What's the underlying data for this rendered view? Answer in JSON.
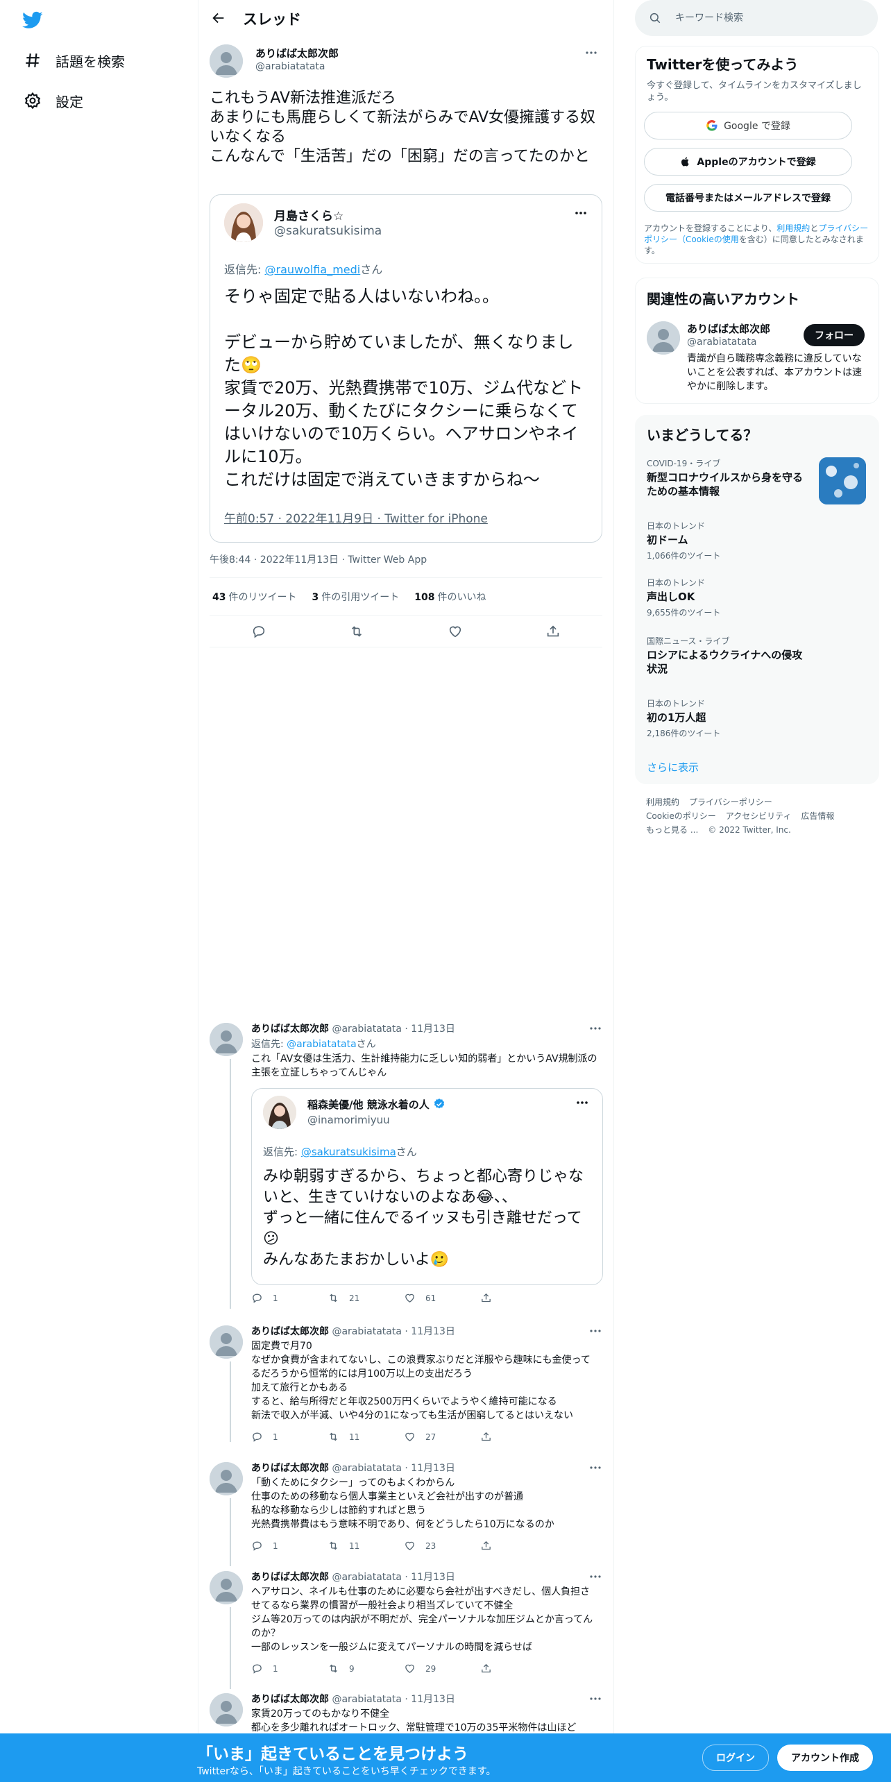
{
  "nav": {
    "explore_label": "話題を検索",
    "settings_label": "設定"
  },
  "thread": {
    "title": "スレッド"
  },
  "main_tweet": {
    "name": "ありばば太郎次郎",
    "handle": "@arabiatatata",
    "text": "これもうAV新法推進派だろ\nあまりにも馬鹿らしくて新法がらみでAV女優擁護する奴いなくなる\nこんなんで「生活苦」だの「困窮」だの言ってたのかと",
    "quote": {
      "name": "月島さくら☆",
      "handle": "@sakuratsukisima",
      "reply_prefix": "返信先: ",
      "reply_to": "@rauwolfia_medi",
      "reply_suffix": "さん",
      "text": "そりゃ固定で貼る人はいないわね。。\n\nデビューから貯めていましたが、無くなりました🙄\n家賃で20万、光熱費携帯で10万、ジム代などトータル20万、動くたびにタクシーに乗らなくてはいけないので10万くらい。ヘアサロンやネイルに10万。\nこれだけは固定で消えていきますからね〜",
      "meta": "午前0:57 · 2022年11月9日 · Twitter for iPhone"
    },
    "meta": "午後8:44 · 2022年11月13日 · Twitter Web App",
    "retweets_count": "43",
    "retweets_label": "件のリツイート",
    "quotes_count": "3",
    "quotes_label": "件の引用ツイート",
    "likes_count": "108",
    "likes_label": "件のいいね"
  },
  "replies": [
    {
      "name": "ありばば太郎次郎",
      "handle": "@arabiatatata",
      "date": "· 11月13日",
      "reply_prefix": "返信先: ",
      "reply_to": "@arabiatatata",
      "reply_suffix": "さん",
      "text": "これ「AV女優は生活力、生計維持能力に乏しい知的弱者」とかいうAV規制派の主張を立証しちゃってんじゃん",
      "quote": {
        "name": "稲森美優/他 競泳水着の人",
        "handle": "@inamorimiyuu",
        "reply_prefix": "返信先: ",
        "reply_to": "@sakuratsukisima",
        "reply_suffix": "さん",
        "text": "みゆ朝弱すぎるから、ちょっと都心寄りじゃないと、生きていけないのよなあ😂、、\nずっと一緒に住んでるイッヌも引き離せだって😕\nみんなあたまおかしいよ🥲"
      },
      "replies": "1",
      "retweets": "21",
      "likes": "61"
    },
    {
      "name": "ありばば太郎次郎",
      "handle": "@arabiatatata",
      "date": "· 11月13日",
      "text": "固定費で月70\nなぜか食費が含まれてないし、この浪費家ぶりだと洋服やら趣味にも金使ってるだろうから恒常的には月100万以上の支出だろう\n加えて旅行とかもある\nすると、給与所得だと年収2500万円くらいでようやく維持可能になる\n新法で収入が半減、いや4分の1になっても生活が困窮してるとはいえない",
      "replies": "1",
      "retweets": "11",
      "likes": "27"
    },
    {
      "name": "ありばば太郎次郎",
      "handle": "@arabiatatata",
      "date": "· 11月13日",
      "text": "「動くためにタクシー」ってのもよくわからん\n仕事のための移動なら個人事業主といえど会社が出すのが普通\n私的な移動なら少しは節約すればと思う\n光熱費携帯費はもう意味不明であり、何をどうしたら10万になるのか",
      "replies": "1",
      "retweets": "11",
      "likes": "23"
    },
    {
      "name": "ありばば太郎次郎",
      "handle": "@arabiatatata",
      "date": "· 11月13日",
      "text": "ヘアサロン、ネイルも仕事のために必要なら会社が出すべきだし、個人負担させてるなら業界の慣習が一般社会より相当ズレていて不健全\nジム等20万ってのは内訳が不明だが、完全パーソナルな加圧ジムとか言ってんのか？\n一部のレッスンを一般ジムに変えてパーソナルの時間を減らせば",
      "replies": "1",
      "retweets": "9",
      "likes": "29"
    },
    {
      "name": "ありばば太郎次郎",
      "handle": "@arabiatatata",
      "date": "· 11月13日",
      "text": "家賃20万ってのもかなり不健全\n都心を多少離れればオートロック、常駐管理で10万の35平米物件は山ほど"
    }
  ],
  "search": {
    "placeholder": "キーワード検索"
  },
  "signup": {
    "title": "Twitterを使ってみよう",
    "description": "今すぐ登録して、タイムラインをカスタマイズしましょう。",
    "google_label": "Google で登録",
    "apple_label": "Appleのアカウントで登録",
    "phone_label": "電話番号またはメールアドレスで登録",
    "legal_prefix": "アカウントを登録することにより、",
    "legal_terms": "利用規約",
    "legal_and": "と",
    "legal_privacy": "プライバシーポリシー（Cookieの使用",
    "legal_suffix": "を含む）に同意したとみなされます。"
  },
  "relevant": {
    "title": "関連性の高いアカウント",
    "name": "ありばば太郎次郎",
    "handle": "@arabiatatata",
    "bio": "青識が自ら職務専念義務に違反していないことを公表すれば、本アカウントは速やかに削除します。",
    "follow_label": "フォロー"
  },
  "trends": {
    "title": "いまどうしてる？",
    "items": [
      {
        "category": "COVID-19・ライブ",
        "name": "新型コロナウイルスから身を守るための基本情報",
        "count": ""
      },
      {
        "category": "日本のトレンド",
        "name": "初ドーム",
        "count": "1,066件のツイート"
      },
      {
        "category": "日本のトレンド",
        "name": "声出しOK",
        "count": "9,655件のツイート"
      },
      {
        "category": "国際ニュース・ライブ",
        "name": "ロシアによるウクライナへの侵攻状況",
        "count": ""
      },
      {
        "category": "日本のトレンド",
        "name": "初の1万人超",
        "count": "2,186件のツイート"
      }
    ],
    "show_more": "さらに表示"
  },
  "footer": {
    "terms": "利用規約",
    "privacy": "プライバシーポリシー",
    "cookie": "Cookieのポリシー",
    "accessibility": "アクセシビリティ",
    "ads": "広告情報",
    "more": "もっと見る ...",
    "copyright": "© 2022 Twitter, Inc."
  },
  "bottom_bar": {
    "title": "「いま」起きていることを見つけよう",
    "subtitle": "Twitterなら、「いま」起きていることをいち早くチェックできます。",
    "login_label": "ログイン",
    "signup_label": "アカウント作成"
  },
  "colors": {
    "accent": "#1d9bf0",
    "text": "#0f1419",
    "muted": "#536471",
    "border": "#eff3f4"
  }
}
